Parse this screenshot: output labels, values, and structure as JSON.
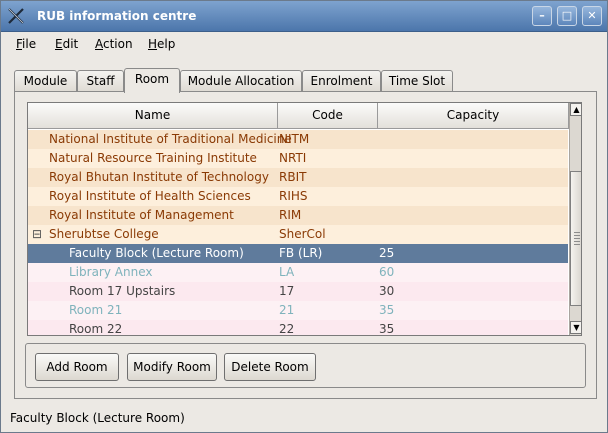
{
  "window": {
    "title": "RUB information centre",
    "minimize_glyph": "–",
    "maximize_glyph": "□",
    "close_glyph": "✕"
  },
  "menu": [
    {
      "key": "F",
      "rest": "ile"
    },
    {
      "key": "E",
      "rest": "dit"
    },
    {
      "key": "A",
      "rest": "ction"
    },
    {
      "key": "H",
      "rest": "elp"
    }
  ],
  "tabs": [
    "Module",
    "Staff",
    "Room",
    "Module Allocation",
    "Enrolment",
    "Time Slot"
  ],
  "active_tab": "Room",
  "table": {
    "headers": [
      "Name",
      "Code",
      "Capacity"
    ],
    "rows": [
      {
        "name": "National Institute of Traditional Medicine",
        "code": "NITM",
        "capacity": "",
        "level": 0,
        "style": "college"
      },
      {
        "name": "Natural Resource Training Institute",
        "code": "NRTI",
        "capacity": "",
        "level": 0,
        "style": "college"
      },
      {
        "name": "Royal Bhutan Institute of Technology",
        "code": "RBIT",
        "capacity": "",
        "level": 0,
        "style": "college"
      },
      {
        "name": "Royal Institute of Health Sciences",
        "code": "RIHS",
        "capacity": "",
        "level": 0,
        "style": "college"
      },
      {
        "name": "Royal Institute of Management",
        "code": "RIM",
        "capacity": "",
        "level": 0,
        "style": "college"
      },
      {
        "name": "Sherubtse College",
        "code": "SherCol",
        "capacity": "",
        "level": 0,
        "style": "college-open",
        "toggle": "⊟"
      },
      {
        "name": "Faculty Block (Lecture Room)",
        "code": "FB (LR)",
        "capacity": "25",
        "level": 1,
        "style": "selected"
      },
      {
        "name": "Library Annex",
        "code": "LA",
        "capacity": "60",
        "level": 1,
        "style": "inactive"
      },
      {
        "name": "Room 17 Upstairs",
        "code": "17",
        "capacity": "30",
        "level": 1,
        "style": "room"
      },
      {
        "name": "Room 21",
        "code": "21",
        "capacity": "35",
        "level": 1,
        "style": "inactive"
      },
      {
        "name": "Room 22",
        "code": "22",
        "capacity": "35",
        "level": 1,
        "style": "room"
      }
    ]
  },
  "scrollbar": {
    "up_glyph": "▲",
    "down_glyph": "▼",
    "position": 0.78
  },
  "buttons": {
    "add": "Add Room",
    "modify": "Modify Room",
    "delete": "Delete Room"
  },
  "status_text": "Faculty Block (Lecture Room)",
  "colors": {
    "college_bg_a": "#f7e4cc",
    "college_bg_b": "#fdefdc",
    "college_text": "#8a3a05",
    "selected_bg": "#5f7b9c",
    "selected_text": "#ffffff",
    "room_bg_a": "#fce9ef",
    "room_bg_b": "#fdf1f4",
    "room_text": "#444444",
    "inactive_text": "#7fb3bc"
  }
}
